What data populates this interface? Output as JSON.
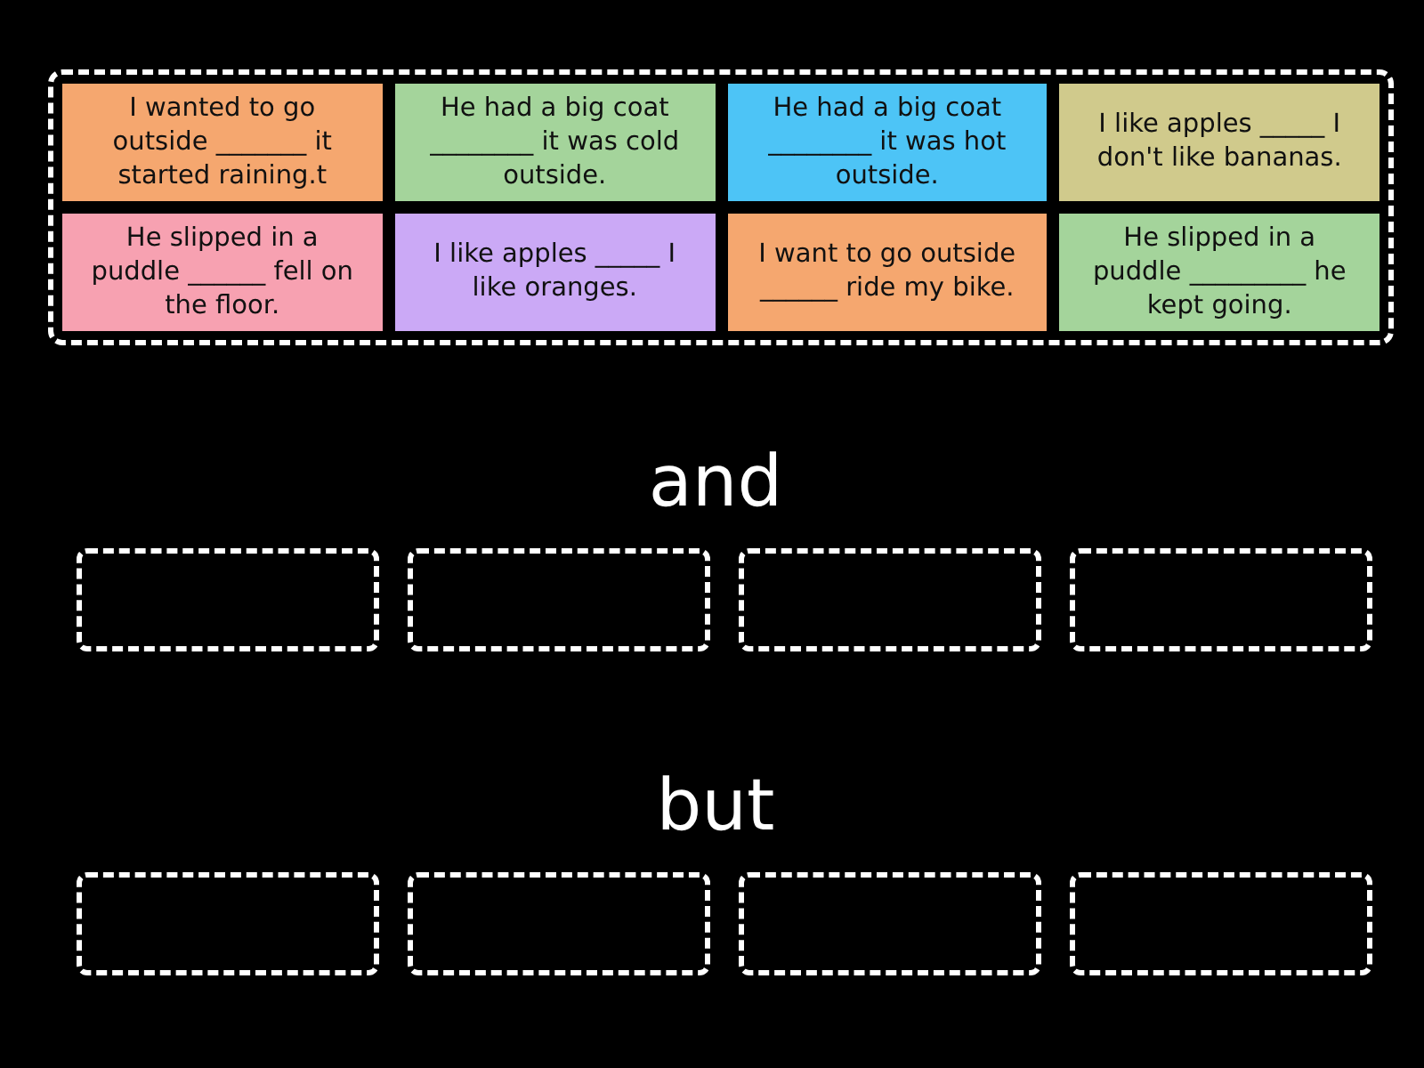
{
  "cards": [
    {
      "text": "I wanted to go outside _______ it started raining.t",
      "color": "#f5a76f"
    },
    {
      "text": "He had a big coat ________ it was cold outside.",
      "color": "#a4d49b"
    },
    {
      "text": "He had a big coat ________ it was hot outside.",
      "color": "#4dc4f6"
    },
    {
      "text": "I like apples _____ I don't like bananas.",
      "color": "#d0ca8c"
    },
    {
      "text": "He slipped in a puddle ______ fell on the floor.",
      "color": "#f7a1b1"
    },
    {
      "text": "I like apples _____ I like oranges.",
      "color": "#cba9f6"
    },
    {
      "text": "I want to go outside ______ ride my bike.",
      "color": "#f5a76f"
    },
    {
      "text": "He slipped in a puddle _________ he kept going.",
      "color": "#a4d49b"
    }
  ],
  "groups": [
    {
      "title": "and"
    },
    {
      "title": "but"
    }
  ]
}
